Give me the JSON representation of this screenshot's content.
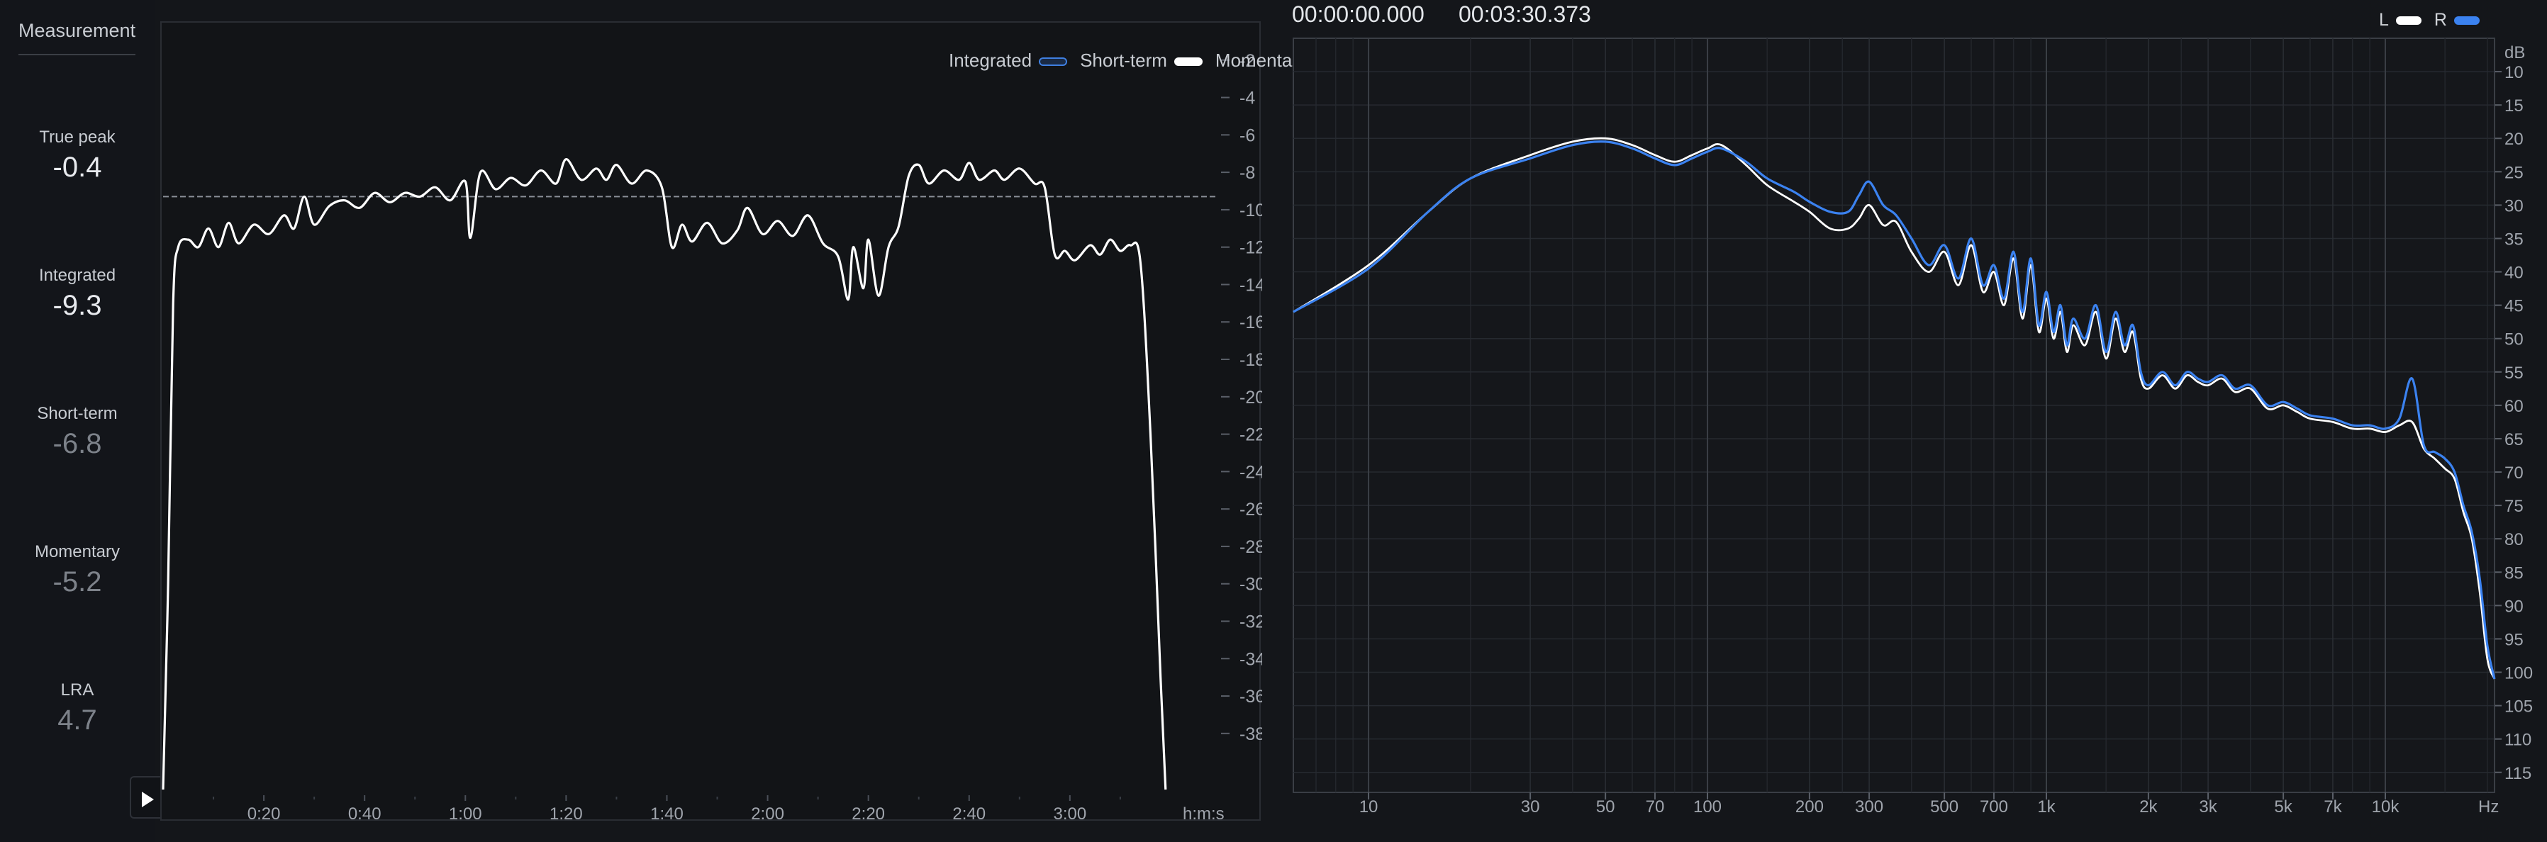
{
  "sidebar": {
    "title": "Measurement",
    "metrics": [
      {
        "label": "True peak",
        "value": "-0.4"
      },
      {
        "label": "Integrated",
        "value": "-9.3"
      },
      {
        "label": "Short-term",
        "value": "-6.8"
      },
      {
        "label": "Momentary",
        "value": "-5.2"
      },
      {
        "label": "LRA",
        "value": "4.7"
      }
    ]
  },
  "colors": {
    "background": "#14161a",
    "integrated": "#3f7fe0",
    "short_term": "#ffffff",
    "momentary": "#4a4f58",
    "channel_l": "#ffffff",
    "channel_r": "#3b82f0",
    "value_active": "#e8eaee",
    "value_inactive": "#7d828a"
  },
  "loudness_legend": {
    "integrated": "Integrated",
    "short_term": "Short-term",
    "momentary": "Momentary"
  },
  "play_button": {
    "icon": "play-icon"
  },
  "spectrum_header": {
    "time_start": "00:00:00.000",
    "time_end": "00:03:30.373",
    "legend_l": "L",
    "legend_r": "R"
  },
  "chart_data": [
    {
      "type": "line",
      "xlabel": "h:m:s",
      "x_tick_labels": [
        "0:20",
        "0:40",
        "1:00",
        "1:20",
        "1:40",
        "2:00",
        "2:20",
        "2:40",
        "3:00"
      ],
      "x_ticks_seconds": [
        20,
        40,
        60,
        80,
        100,
        120,
        140,
        160,
        180
      ],
      "xlim": [
        0,
        210
      ],
      "y_tick_labels": [
        "-2",
        "-4",
        "-6",
        "-8",
        "-10",
        "-12",
        "-14",
        "-16",
        "-18",
        "-20",
        "-22",
        "-24",
        "-26",
        "-28",
        "-30",
        "-32",
        "-34",
        "-36",
        "-38"
      ],
      "ylim": [
        -41,
        0
      ],
      "integrated_value": -9.3,
      "series": [
        {
          "name": "Short-term",
          "points": [
            [
              0,
              -41
            ],
            [
              1,
              -30
            ],
            [
              2,
              -15
            ],
            [
              3,
              -12
            ],
            [
              5,
              -11.6
            ],
            [
              7,
              -12
            ],
            [
              9,
              -11
            ],
            [
              11,
              -12
            ],
            [
              13,
              -10.7
            ],
            [
              15,
              -11.8
            ],
            [
              18,
              -10.8
            ],
            [
              21,
              -11.3
            ],
            [
              24,
              -10.3
            ],
            [
              26,
              -11
            ],
            [
              28,
              -9.3
            ],
            [
              30,
              -10.8
            ],
            [
              33,
              -9.8
            ],
            [
              36,
              -9.5
            ],
            [
              39,
              -9.9
            ],
            [
              42,
              -9.1
            ],
            [
              45,
              -9.6
            ],
            [
              48,
              -9.1
            ],
            [
              51,
              -9.3
            ],
            [
              54,
              -8.8
            ],
            [
              57,
              -9.5
            ],
            [
              60,
              -8.5
            ],
            [
              61,
              -11.5
            ],
            [
              63,
              -8
            ],
            [
              66,
              -8.9
            ],
            [
              69,
              -8.3
            ],
            [
              72,
              -8.7
            ],
            [
              75,
              -7.9
            ],
            [
              78,
              -8.6
            ],
            [
              80,
              -7.3
            ],
            [
              83,
              -8.4
            ],
            [
              86,
              -7.8
            ],
            [
              88,
              -8.4
            ],
            [
              90,
              -7.6
            ],
            [
              93,
              -8.6
            ],
            [
              96,
              -7.9
            ],
            [
              99,
              -8.8
            ],
            [
              101,
              -12
            ],
            [
              103,
              -10.8
            ],
            [
              105,
              -11.7
            ],
            [
              108,
              -10.7
            ],
            [
              111,
              -11.8
            ],
            [
              114,
              -11.1
            ],
            [
              116,
              -9.9
            ],
            [
              119,
              -11.3
            ],
            [
              122,
              -10.6
            ],
            [
              125,
              -11.4
            ],
            [
              128,
              -10.3
            ],
            [
              131,
              -11.8
            ],
            [
              134,
              -12.5
            ],
            [
              136,
              -14.8
            ],
            [
              137,
              -12
            ],
            [
              139,
              -14.2
            ],
            [
              140,
              -11.6
            ],
            [
              142,
              -14.6
            ],
            [
              144,
              -12
            ],
            [
              146,
              -10.9
            ],
            [
              148,
              -8.2
            ],
            [
              150,
              -7.6
            ],
            [
              152,
              -8.6
            ],
            [
              155,
              -7.9
            ],
            [
              158,
              -8.4
            ],
            [
              160,
              -7.5
            ],
            [
              162,
              -8.4
            ],
            [
              165,
              -7.9
            ],
            [
              167,
              -8.4
            ],
            [
              170,
              -7.8
            ],
            [
              173,
              -8.6
            ],
            [
              175,
              -8.8
            ],
            [
              177,
              -12.4
            ],
            [
              179,
              -12.2
            ],
            [
              181,
              -12.7
            ],
            [
              184,
              -11.9
            ],
            [
              186,
              -12.4
            ],
            [
              188,
              -11.6
            ],
            [
              190,
              -12.2
            ],
            [
              192,
              -11.9
            ],
            [
              194,
              -12.8
            ],
            [
              196,
              -22
            ],
            [
              198,
              -35
            ],
            [
              199,
              -41
            ]
          ]
        }
      ]
    },
    {
      "type": "line",
      "ylabel": "dB",
      "xlabel": "Hz",
      "x_tick_labels": [
        "10",
        "30",
        "50",
        "70",
        "100",
        "200",
        "300",
        "500",
        "700",
        "1k",
        "2k",
        "3k",
        "5k",
        "7k",
        "10k",
        "Hz"
      ],
      "x_ticks_hz": [
        10,
        30,
        50,
        70,
        100,
        200,
        300,
        500,
        700,
        1000,
        2000,
        3000,
        5000,
        7000,
        10000
      ],
      "xlim_hz": [
        6,
        21000
      ],
      "x_scale": "log",
      "y_tick_labels": [
        "dB",
        "10",
        "15",
        "20",
        "25",
        "30",
        "35",
        "40",
        "45",
        "50",
        "55",
        "60",
        "65",
        "70",
        "75",
        "80",
        "85",
        "90",
        "95",
        "100",
        "105",
        "110",
        "115"
      ],
      "ylim_db_below_0": [
        5,
        118
      ],
      "y_inverted": true,
      "series": [
        {
          "name": "L",
          "points": [
            [
              6,
              46
            ],
            [
              10,
              39
            ],
            [
              15,
              31
            ],
            [
              20,
              26
            ],
            [
              30,
              22.5
            ],
            [
              40,
              20.5
            ],
            [
              50,
              20
            ],
            [
              60,
              21
            ],
            [
              70,
              22.5
            ],
            [
              80,
              23.5
            ],
            [
              90,
              22.5
            ],
            [
              100,
              21.5
            ],
            [
              110,
              21
            ],
            [
              130,
              24
            ],
            [
              150,
              27
            ],
            [
              180,
              29.5
            ],
            [
              200,
              31
            ],
            [
              230,
              33.5
            ],
            [
              260,
              33.5
            ],
            [
              280,
              32
            ],
            [
              300,
              30
            ],
            [
              330,
              33
            ],
            [
              360,
              32.5
            ],
            [
              400,
              37
            ],
            [
              450,
              40
            ],
            [
              500,
              37
            ],
            [
              550,
              42
            ],
            [
              600,
              36
            ],
            [
              650,
              43
            ],
            [
              700,
              40
            ],
            [
              750,
              45
            ],
            [
              800,
              38
            ],
            [
              850,
              47
            ],
            [
              900,
              39
            ],
            [
              950,
              49
            ],
            [
              1000,
              44
            ],
            [
              1050,
              50
            ],
            [
              1100,
              46
            ],
            [
              1150,
              52
            ],
            [
              1200,
              48
            ],
            [
              1300,
              51
            ],
            [
              1400,
              46
            ],
            [
              1500,
              53
            ],
            [
              1600,
              47
            ],
            [
              1700,
              52
            ],
            [
              1800,
              49
            ],
            [
              1900,
              56
            ],
            [
              2000,
              57.5
            ],
            [
              2200,
              55.5
            ],
            [
              2400,
              57.5
            ],
            [
              2600,
              55.5
            ],
            [
              2800,
              56.5
            ],
            [
              3000,
              57
            ],
            [
              3300,
              56
            ],
            [
              3600,
              58
            ],
            [
              4000,
              57.5
            ],
            [
              4500,
              60.5
            ],
            [
              5000,
              60
            ],
            [
              5500,
              61
            ],
            [
              6000,
              62
            ],
            [
              7000,
              62.5
            ],
            [
              8000,
              63.5
            ],
            [
              9000,
              63.5
            ],
            [
              10000,
              64
            ],
            [
              11000,
              63
            ],
            [
              12000,
              62.5
            ],
            [
              13000,
              66.5
            ],
            [
              14000,
              68
            ],
            [
              15000,
              69.5
            ],
            [
              16000,
              71
            ],
            [
              17000,
              76
            ],
            [
              18000,
              80
            ],
            [
              19000,
              88
            ],
            [
              20000,
              98
            ],
            [
              21000,
              101
            ]
          ]
        },
        {
          "name": "R",
          "points": [
            [
              6,
              46
            ],
            [
              10,
              39.5
            ],
            [
              15,
              31
            ],
            [
              20,
              26
            ],
            [
              30,
              23
            ],
            [
              40,
              21
            ],
            [
              50,
              20.5
            ],
            [
              60,
              21.5
            ],
            [
              70,
              23
            ],
            [
              80,
              24
            ],
            [
              90,
              23
            ],
            [
              100,
              22
            ],
            [
              110,
              21.5
            ],
            [
              130,
              23.5
            ],
            [
              150,
              26
            ],
            [
              180,
              28
            ],
            [
              200,
              29.5
            ],
            [
              230,
              31
            ],
            [
              260,
              31
            ],
            [
              280,
              28.5
            ],
            [
              300,
              26.5
            ],
            [
              330,
              30
            ],
            [
              360,
              31.5
            ],
            [
              400,
              35
            ],
            [
              450,
              39
            ],
            [
              500,
              36
            ],
            [
              550,
              41
            ],
            [
              600,
              35
            ],
            [
              650,
              42
            ],
            [
              700,
              39
            ],
            [
              750,
              44
            ],
            [
              800,
              37
            ],
            [
              850,
              46
            ],
            [
              900,
              38
            ],
            [
              950,
              48
            ],
            [
              1000,
              43
            ],
            [
              1050,
              49
            ],
            [
              1100,
              45
            ],
            [
              1150,
              51
            ],
            [
              1200,
              47
            ],
            [
              1300,
              50
            ],
            [
              1400,
              45
            ],
            [
              1500,
              52
            ],
            [
              1600,
              46
            ],
            [
              1700,
              51
            ],
            [
              1800,
              48
            ],
            [
              1900,
              55
            ],
            [
              2000,
              57
            ],
            [
              2200,
              55
            ],
            [
              2400,
              57
            ],
            [
              2600,
              55
            ],
            [
              2800,
              56
            ],
            [
              3000,
              56.5
            ],
            [
              3300,
              55.5
            ],
            [
              3600,
              57.5
            ],
            [
              4000,
              57
            ],
            [
              4500,
              60
            ],
            [
              5000,
              59.5
            ],
            [
              5500,
              60.5
            ],
            [
              6000,
              61.5
            ],
            [
              7000,
              62
            ],
            [
              8000,
              63
            ],
            [
              9000,
              63
            ],
            [
              10000,
              63.5
            ],
            [
              11000,
              62
            ],
            [
              12000,
              56
            ],
            [
              13000,
              66
            ],
            [
              14000,
              67
            ],
            [
              15000,
              68
            ],
            [
              16000,
              70
            ],
            [
              17000,
              75
            ],
            [
              18000,
              79
            ],
            [
              19000,
              86
            ],
            [
              20000,
              96
            ],
            [
              21000,
              101
            ]
          ]
        }
      ]
    }
  ]
}
